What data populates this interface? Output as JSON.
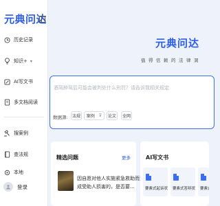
{
  "app": {
    "logo": "元典问达",
    "brand": "元典问达",
    "tagline": "值得信赖的法律洞"
  },
  "sidebar": {
    "items": [
      {
        "label": "历史记录",
        "icon": "history-icon"
      },
      {
        "label": "知识+",
        "icon": "bulb-icon"
      },
      {
        "label": "AI写文书",
        "icon": "ai-write-icon"
      },
      {
        "label": "多文档阅读",
        "icon": "document-icon"
      },
      {
        "label": "搜案例",
        "icon": "gavel-icon"
      },
      {
        "label": "查法规",
        "icon": "law-book-icon"
      },
      {
        "label": "本地",
        "icon": "local-icon"
      }
    ],
    "login_label": "登录"
  },
  "search": {
    "placeholder": "酒驾醉驾后可能会被判处什么刑罚？请告诉我相关规定",
    "source_label": "数据源:",
    "chips": [
      "法规",
      "案例",
      "论文",
      "全网"
    ]
  },
  "featured": {
    "title": "精选问题",
    "more": "更多",
    "question": "因自愿对他人实施紧急救助而造成受助人损害的，是否要..."
  },
  "ai_write": {
    "title": "AI写文书",
    "docs": [
      "要素式起诉状",
      "要素式答辩状",
      "要素式"
    ]
  }
}
